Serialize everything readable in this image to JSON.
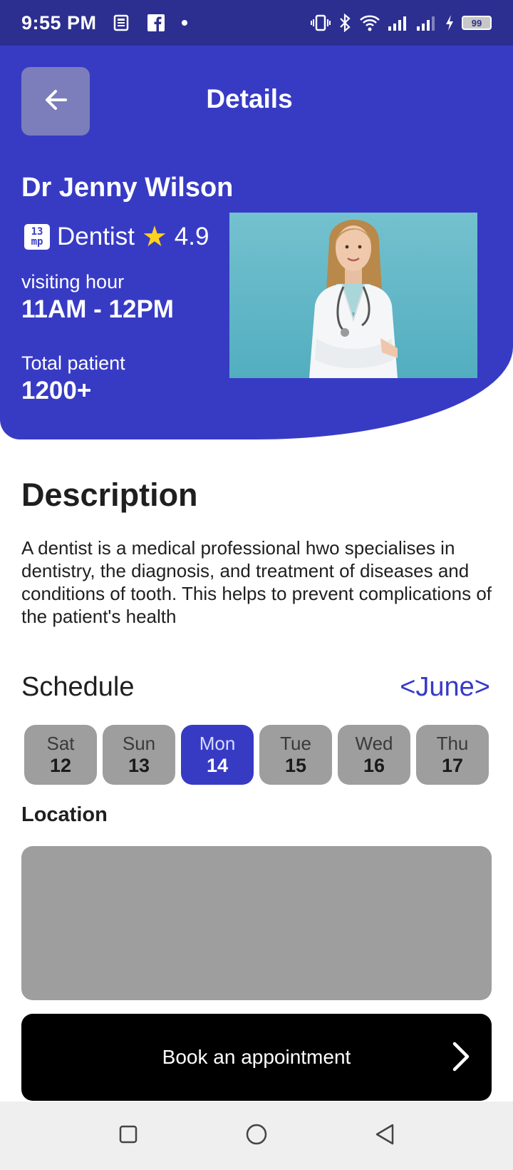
{
  "status_bar": {
    "time": "9:55 PM",
    "battery": "99",
    "icons": [
      "news-icon",
      "facebook-icon",
      "dot-icon",
      "vibrate-icon",
      "bluetooth-icon",
      "wifi-icon",
      "signal-icon",
      "signal-icon",
      "charging-icon",
      "battery-icon"
    ]
  },
  "header": {
    "title": "Details",
    "back_icon": "arrow-left-icon"
  },
  "doctor": {
    "name": "Dr Jenny Wilson",
    "specialty": "Dentist",
    "rating": "4.9",
    "badge_top": "13",
    "badge_bottom": "mp",
    "visiting_label": "visiting hour",
    "visiting_value": "11AM - 12PM",
    "patients_label": "Total patient",
    "patients_value": "1200+"
  },
  "description": {
    "title": "Description",
    "text": "A dentist is a medical professional hwo specialises in dentistry, the diagnosis, and treatment of diseases and conditions of tooth. This helps to prevent complications of the patient's health"
  },
  "schedule": {
    "title": "Schedule",
    "month": "<June>",
    "days": [
      {
        "name": "Sat",
        "num": "12"
      },
      {
        "name": "Sun",
        "num": "13"
      },
      {
        "name": "Mon",
        "num": "14"
      },
      {
        "name": "Tue",
        "num": "15"
      },
      {
        "name": "Wed",
        "num": "16"
      },
      {
        "name": "Thu",
        "num": "17"
      }
    ],
    "selected": "Mon"
  },
  "location": {
    "title": "Location"
  },
  "book": {
    "label": "Book an appointment"
  },
  "colors": {
    "primary": "#373bc4",
    "status_bar": "#2c2f8f",
    "chip": "#9e9e9e",
    "star": "#ffd21f"
  }
}
